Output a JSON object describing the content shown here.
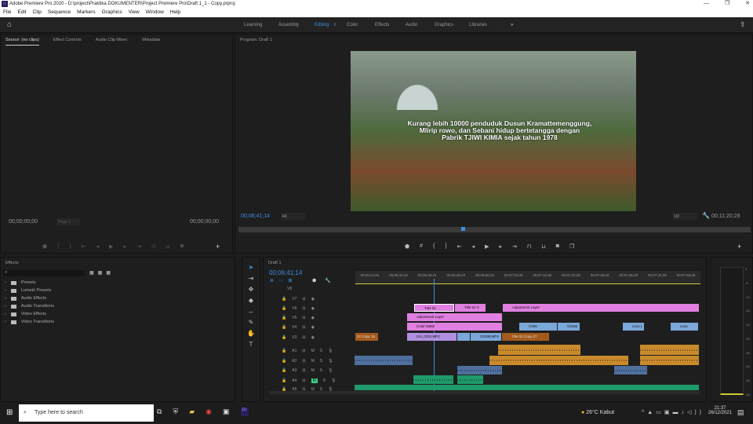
{
  "window": {
    "title": "Adobe Premiere Pro 2020 - D:\\project\\Praktika DOKUMENTER\\Project Premiere Pro\\Draft 1_1 - Copy.prproj",
    "app_icon": "Pr"
  },
  "menu": [
    "File",
    "Edit",
    "Clip",
    "Sequence",
    "Markers",
    "Graphics",
    "View",
    "Window",
    "Help"
  ],
  "workspaces": [
    "Learning",
    "Assembly",
    "Editing",
    "Color",
    "Effects",
    "Audio",
    "Graphics",
    "Libraries"
  ],
  "active_workspace": "Editing",
  "source_panel": {
    "tabs": [
      "Source: (no clips)",
      "Effect Controls",
      "Audio Clip Mixer:",
      "Metadata"
    ],
    "timecode_left": "00;00;00;00",
    "timecode_right": "00;00;00;00",
    "page": "Page 1"
  },
  "program_panel": {
    "title": "Program: Draft 1",
    "timecode": "00;06;41;14",
    "fit": "Fit",
    "resolution": "1/2",
    "duration": "00;11;20;28",
    "subtitle_lines": [
      "Kurang lebih 10000 penduduk Dusun Kramattemenggung,",
      "Mlirip rowo, dan Sebani hidup bertetangga dengan",
      "Pabrik TJIWI KIMIA sejak tahun 1978"
    ]
  },
  "effects_panel": {
    "title": "Effects",
    "search_placeholder": "",
    "folders": [
      "Presets",
      "Lumetri Presets",
      "Audio Effects",
      "Audio Transitions",
      "Video Effects",
      "Video Transitions"
    ]
  },
  "timeline": {
    "title": "Draft 1",
    "timecode": "00;06;41;14",
    "ruler": [
      "00;06;24;24",
      "00;06;32;24",
      "00;06;40;24",
      "00;06;48;24",
      "00;06;56;24",
      "00;07;04;28",
      "00;07;12;28",
      "00;07;20;28",
      "00;07;28;28",
      "00;07;36;28",
      "00;07;44;28",
      "00;07;52;28"
    ],
    "video_tracks": [
      "V8",
      "V7",
      "V6",
      "V5",
      "V4",
      "V3"
    ],
    "audio_tracks": [
      "A1",
      "A2",
      "A3",
      "A4",
      "A5"
    ],
    "clips": {
      "v6": [
        "Title 01",
        "Title 01 C",
        "Adjustment Layer"
      ],
      "v5": [
        "Adjustment Layer"
      ],
      "v4": [
        "Color Matte",
        "C006",
        "C0182",
        "cooo [",
        "cooo"
      ],
      "v3": [
        "02 Copy 16",
        "DJI_0331.MP4",
        "C0198.MP4",
        "Title 02 Copy 07"
      ]
    },
    "mute_label": "M",
    "solo_label": "S"
  },
  "meter": {
    "scale": [
      "0",
      "-6",
      "-12",
      "-18",
      "-24",
      "-30",
      "-36",
      "-42",
      "-48",
      "-54",
      "dB"
    ]
  },
  "taskbar": {
    "search_placeholder": "Type here to search",
    "weather": "26°C  Kabut",
    "time": "21:37",
    "date": "26/12/2021"
  }
}
